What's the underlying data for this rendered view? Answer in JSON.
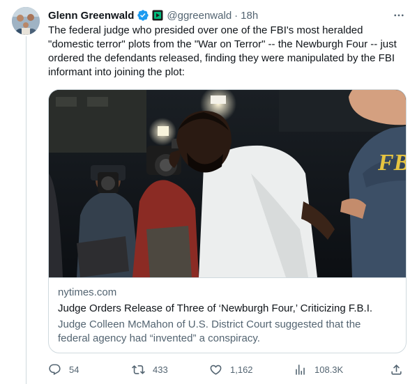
{
  "tweet": {
    "author_name": "Glenn Greenwald",
    "handle": "@ggreenwald",
    "separator": "·",
    "time": "18h",
    "more_label": "···",
    "text": "The federal judge who presided over one of the FBI's most heralded \"domestic terror\" plots from the \"War on Terror\" -- the Newburgh Four -- just ordered the defendants released, finding they were manipulated by the FBI informant into joining the plot:"
  },
  "card": {
    "domain": "nytimes.com",
    "title": "Judge Orders Release of Three of ‘Newburgh Four,’ Criticizing F.B.I.",
    "description": "Judge Colleen McMahon of U.S. District Court suggested that the federal agency had “invented” a conspiracy.",
    "image_jacket_text": "FBI"
  },
  "actions": {
    "replies": "54",
    "retweets": "433",
    "likes": "1,162",
    "views": "108.3K"
  },
  "colors": {
    "verified_blue": "#1d9bf0",
    "secondary_text": "#536471",
    "border": "#cfd9de",
    "sub_badge": "#00ba7c"
  }
}
